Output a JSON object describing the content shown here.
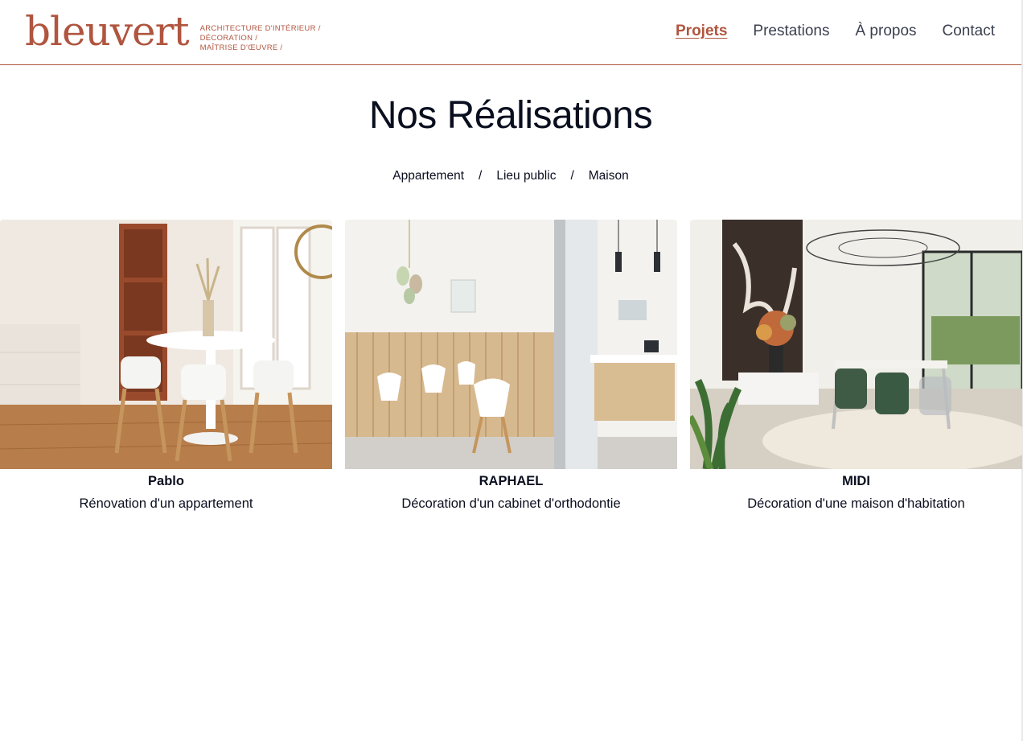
{
  "brand": {
    "name": "bleuvert",
    "tagline": [
      "ARCHITECTURE D'INTÉRIEUR /",
      "DÉCORATION /",
      "MAÎTRISE D'ŒUVRE /"
    ],
    "color": "#b0553f"
  },
  "nav": {
    "items": [
      {
        "label": "Projets",
        "active": true
      },
      {
        "label": "Prestations",
        "active": false
      },
      {
        "label": "À propos",
        "active": false
      },
      {
        "label": "Contact",
        "active": false
      }
    ]
  },
  "main": {
    "title": "Nos Réalisations",
    "filters": [
      "Appartement",
      "Lieu public",
      "Maison"
    ],
    "separator": "/",
    "projects": [
      {
        "name": "Pablo",
        "description": "Rénovation d'un appartement",
        "image": "dining-room-photo"
      },
      {
        "name": "RAPHAEL",
        "description": "Décoration d'un cabinet d'orthodontie",
        "image": "waiting-room-photo"
      },
      {
        "name": "MIDI",
        "description": "Décoration d'une maison d'habitation",
        "image": "house-dining-photo"
      }
    ]
  }
}
